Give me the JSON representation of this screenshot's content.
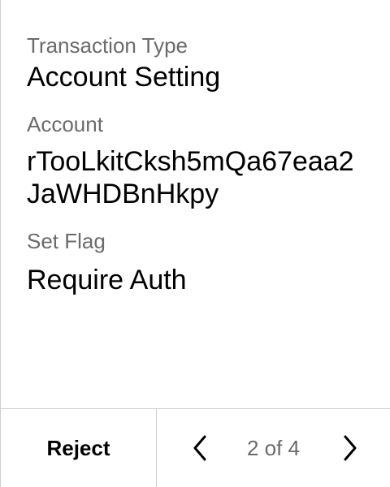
{
  "fields": [
    {
      "label": "Transaction Type",
      "value": "Account Setting"
    },
    {
      "label": "Account",
      "value": "rTooLkitCksh5mQa67eaa2JaWHDBnHkpy"
    },
    {
      "label": "Set Flag",
      "value": "Require Auth"
    }
  ],
  "footer": {
    "reject_label": "Reject",
    "page_indicator": "2 of 4",
    "prev_icon": "chevron-left-icon",
    "next_icon": "chevron-right-icon"
  },
  "colors": {
    "label": "#6b6b6b",
    "value": "#000000",
    "divider": "#d0d0d0",
    "background": "#ffffff"
  }
}
